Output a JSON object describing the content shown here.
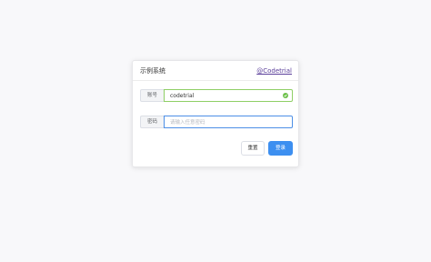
{
  "card": {
    "title": "示例系统",
    "link": "@Codetrial"
  },
  "form": {
    "account": {
      "label": "账号",
      "value": "codetrial",
      "state": "valid"
    },
    "password": {
      "label": "密码",
      "value": "",
      "placeholder": "请输入任意密码",
      "state": "focused"
    }
  },
  "buttons": {
    "reset": "重置",
    "login": "登录"
  },
  "colors": {
    "primary": "#3d8ff0",
    "success": "#6cc04a",
    "link": "#5a3e9a",
    "focus_border": "#4d8fe6",
    "valid_border": "#8fcf66"
  },
  "icons": {
    "account_status": "check-circle-icon"
  }
}
